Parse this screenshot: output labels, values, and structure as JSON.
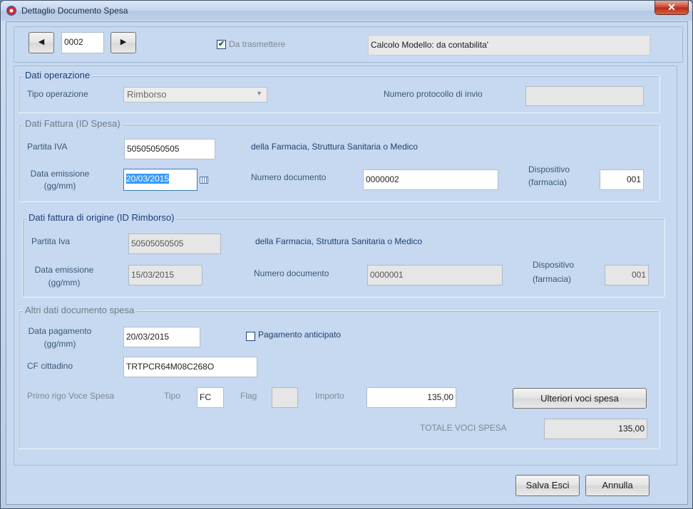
{
  "window": {
    "title": "Dettaglio Documento Spesa",
    "close_glyph": "✕"
  },
  "nav": {
    "prev_glyph": "◀",
    "record_number": "0002",
    "next_glyph": "▶",
    "da_trasmettere_label": "Da trasmettere",
    "da_trasmettere_checked": true,
    "calcolo_modello": "Calcolo Modello: da contabilita'"
  },
  "dati_operazione": {
    "legend": "Dati operazione",
    "tipo_operazione_label": "Tipo operazione",
    "tipo_operazione_value": "Rimborso",
    "protocollo_label": "Numero protocollo di invio",
    "protocollo_value": ""
  },
  "dati_fattura": {
    "legend": "Dati Fattura (ID Spesa)",
    "partita_iva_label": "Partita IVA",
    "partita_iva_value": "50505050505",
    "partita_iva_hint": "della Farmacia, Struttura Sanitaria o Medico",
    "data_emissione_label_1": "Data emissione",
    "data_emissione_label_2": "(gg/mm)",
    "data_emissione_value": "20/03/2015",
    "numero_documento_label": "Numero documento",
    "numero_documento_value": "0000002",
    "dispositivo_label_1": "Dispositivo",
    "dispositivo_label_2": "(farmacia)",
    "dispositivo_value": "001"
  },
  "dati_fattura_origine": {
    "legend": "Dati fattura di origine (ID Rimborso)",
    "partita_iva_label": "Partita Iva",
    "partita_iva_value": "50505050505",
    "partita_iva_hint": "della Farmacia, Struttura Sanitaria o Medico",
    "data_emissione_label_1": "Data emissione",
    "data_emissione_label_2": "(gg/mm)",
    "data_emissione_value": "15/03/2015",
    "numero_documento_label": "Numero documento",
    "numero_documento_value": "0000001",
    "dispositivo_label_1": "Dispositivo",
    "dispositivo_label_2": "(farmacia)",
    "dispositivo_value": "001"
  },
  "altri_dati": {
    "legend": "Altri dati documento spesa",
    "data_pagamento_label_1": "Data pagamento",
    "data_pagamento_label_2": "(gg/mm)",
    "data_pagamento_value": "20/03/2015",
    "pagamento_anticipato_label": "Pagamento anticipato",
    "pagamento_anticipato_checked": false,
    "cf_label": "CF cittadino",
    "cf_value": "TRTPCR64M08C268O",
    "primo_rigo_label": "Primo rigo Voce Spesa",
    "tipo_label": "Tipo",
    "tipo_value": "FC",
    "flag_label": "Flag",
    "flag_value": "",
    "importo_label": "Importo",
    "importo_value": "135,00",
    "ulteriori_button": "Ulteriori voci spesa",
    "totale_label": "TOTALE VOCI SPESA",
    "totale_value": "135,00"
  },
  "footer": {
    "salva_button": "Salva Esci",
    "annulla_button": "Annulla"
  }
}
